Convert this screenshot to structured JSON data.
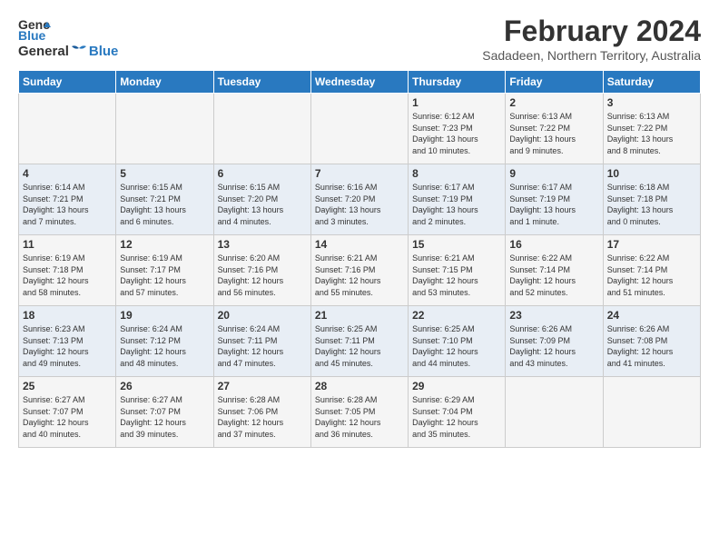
{
  "header": {
    "logo_general": "General",
    "logo_blue": "Blue",
    "month_year": "February 2024",
    "location": "Sadadeen, Northern Territory, Australia"
  },
  "days_of_week": [
    "Sunday",
    "Monday",
    "Tuesday",
    "Wednesday",
    "Thursday",
    "Friday",
    "Saturday"
  ],
  "weeks": [
    [
      {
        "day": "",
        "content": ""
      },
      {
        "day": "",
        "content": ""
      },
      {
        "day": "",
        "content": ""
      },
      {
        "day": "",
        "content": ""
      },
      {
        "day": "1",
        "content": "Sunrise: 6:12 AM\nSunset: 7:23 PM\nDaylight: 13 hours\nand 10 minutes."
      },
      {
        "day": "2",
        "content": "Sunrise: 6:13 AM\nSunset: 7:22 PM\nDaylight: 13 hours\nand 9 minutes."
      },
      {
        "day": "3",
        "content": "Sunrise: 6:13 AM\nSunset: 7:22 PM\nDaylight: 13 hours\nand 8 minutes."
      }
    ],
    [
      {
        "day": "4",
        "content": "Sunrise: 6:14 AM\nSunset: 7:21 PM\nDaylight: 13 hours\nand 7 minutes."
      },
      {
        "day": "5",
        "content": "Sunrise: 6:15 AM\nSunset: 7:21 PM\nDaylight: 13 hours\nand 6 minutes."
      },
      {
        "day": "6",
        "content": "Sunrise: 6:15 AM\nSunset: 7:20 PM\nDaylight: 13 hours\nand 4 minutes."
      },
      {
        "day": "7",
        "content": "Sunrise: 6:16 AM\nSunset: 7:20 PM\nDaylight: 13 hours\nand 3 minutes."
      },
      {
        "day": "8",
        "content": "Sunrise: 6:17 AM\nSunset: 7:19 PM\nDaylight: 13 hours\nand 2 minutes."
      },
      {
        "day": "9",
        "content": "Sunrise: 6:17 AM\nSunset: 7:19 PM\nDaylight: 13 hours\nand 1 minute."
      },
      {
        "day": "10",
        "content": "Sunrise: 6:18 AM\nSunset: 7:18 PM\nDaylight: 13 hours\nand 0 minutes."
      }
    ],
    [
      {
        "day": "11",
        "content": "Sunrise: 6:19 AM\nSunset: 7:18 PM\nDaylight: 12 hours\nand 58 minutes."
      },
      {
        "day": "12",
        "content": "Sunrise: 6:19 AM\nSunset: 7:17 PM\nDaylight: 12 hours\nand 57 minutes."
      },
      {
        "day": "13",
        "content": "Sunrise: 6:20 AM\nSunset: 7:16 PM\nDaylight: 12 hours\nand 56 minutes."
      },
      {
        "day": "14",
        "content": "Sunrise: 6:21 AM\nSunset: 7:16 PM\nDaylight: 12 hours\nand 55 minutes."
      },
      {
        "day": "15",
        "content": "Sunrise: 6:21 AM\nSunset: 7:15 PM\nDaylight: 12 hours\nand 53 minutes."
      },
      {
        "day": "16",
        "content": "Sunrise: 6:22 AM\nSunset: 7:14 PM\nDaylight: 12 hours\nand 52 minutes."
      },
      {
        "day": "17",
        "content": "Sunrise: 6:22 AM\nSunset: 7:14 PM\nDaylight: 12 hours\nand 51 minutes."
      }
    ],
    [
      {
        "day": "18",
        "content": "Sunrise: 6:23 AM\nSunset: 7:13 PM\nDaylight: 12 hours\nand 49 minutes."
      },
      {
        "day": "19",
        "content": "Sunrise: 6:24 AM\nSunset: 7:12 PM\nDaylight: 12 hours\nand 48 minutes."
      },
      {
        "day": "20",
        "content": "Sunrise: 6:24 AM\nSunset: 7:11 PM\nDaylight: 12 hours\nand 47 minutes."
      },
      {
        "day": "21",
        "content": "Sunrise: 6:25 AM\nSunset: 7:11 PM\nDaylight: 12 hours\nand 45 minutes."
      },
      {
        "day": "22",
        "content": "Sunrise: 6:25 AM\nSunset: 7:10 PM\nDaylight: 12 hours\nand 44 minutes."
      },
      {
        "day": "23",
        "content": "Sunrise: 6:26 AM\nSunset: 7:09 PM\nDaylight: 12 hours\nand 43 minutes."
      },
      {
        "day": "24",
        "content": "Sunrise: 6:26 AM\nSunset: 7:08 PM\nDaylight: 12 hours\nand 41 minutes."
      }
    ],
    [
      {
        "day": "25",
        "content": "Sunrise: 6:27 AM\nSunset: 7:07 PM\nDaylight: 12 hours\nand 40 minutes."
      },
      {
        "day": "26",
        "content": "Sunrise: 6:27 AM\nSunset: 7:07 PM\nDaylight: 12 hours\nand 39 minutes."
      },
      {
        "day": "27",
        "content": "Sunrise: 6:28 AM\nSunset: 7:06 PM\nDaylight: 12 hours\nand 37 minutes."
      },
      {
        "day": "28",
        "content": "Sunrise: 6:28 AM\nSunset: 7:05 PM\nDaylight: 12 hours\nand 36 minutes."
      },
      {
        "day": "29",
        "content": "Sunrise: 6:29 AM\nSunset: 7:04 PM\nDaylight: 12 hours\nand 35 minutes."
      },
      {
        "day": "",
        "content": ""
      },
      {
        "day": "",
        "content": ""
      }
    ]
  ]
}
